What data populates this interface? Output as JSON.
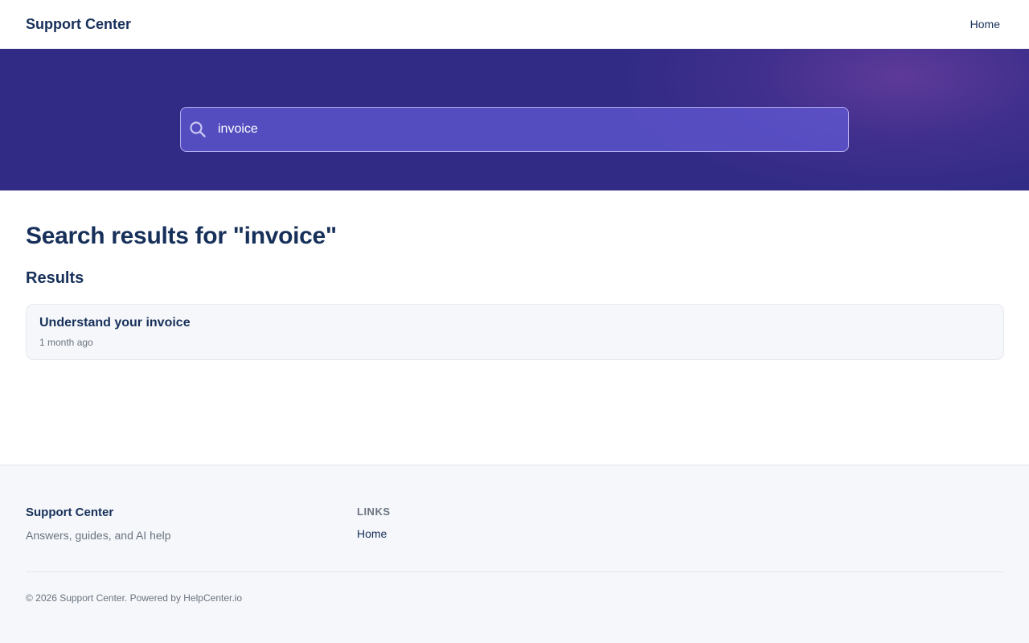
{
  "header": {
    "brand": "Support Center",
    "nav": [
      {
        "label": "Home"
      }
    ]
  },
  "search": {
    "value": "invoice",
    "icon": "search-icon"
  },
  "main": {
    "title": "Search results for \"invoice\"",
    "section_title": "Results",
    "results": [
      {
        "title": "Understand your invoice",
        "meta": "1 month ago"
      }
    ]
  },
  "footer": {
    "brand": "Support Center",
    "tagline": "Answers, guides, and AI help",
    "links_heading": "LINKS",
    "links": [
      {
        "label": "Home"
      }
    ],
    "copyright": "© 2026 Support Center. Powered by HelpCenter.io"
  },
  "colors": {
    "hero": "#312b86",
    "brand_text": "#17305a",
    "muted_text": "#6b7380",
    "card_bg": "#f5f7fa"
  }
}
